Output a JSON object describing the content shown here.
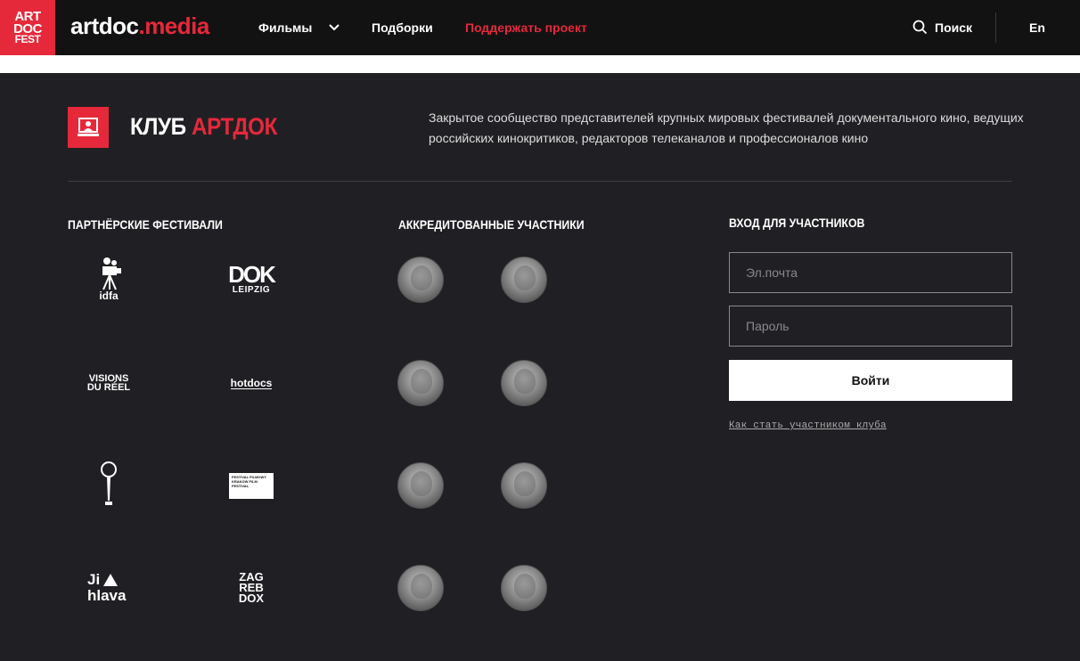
{
  "header": {
    "logo_lines": [
      "ART",
      "DOC",
      "FEST"
    ],
    "brand_main": "artdoc",
    "brand_dot": ".media",
    "nav": {
      "films": "Фильмы",
      "collections": "Подборки",
      "support": "Поддержать проект"
    },
    "search_label": "Поиск",
    "lang_label": "En"
  },
  "club": {
    "title_white": "КЛУБ",
    "title_red": "АРТДОК",
    "description": "Закрытое сообщество представителей крупных мировых фестивалей документального кино, ведущих российских кинокритиков, редакторов телеканалов и профессионалов кино"
  },
  "sections": {
    "partners": "ПАРТНЁРСКИЕ ФЕСТИВАЛИ",
    "members": "АККРЕДИТОВАННЫЕ УЧАСТНИКИ",
    "login": "ВХОД ДЛЯ УЧАСТНИКОВ"
  },
  "festivals": [
    {
      "name": "idfa"
    },
    {
      "name": "DOK LEIPZIG"
    },
    {
      "name": "VISIONS DU RÉEL"
    },
    {
      "name": "hotdocs"
    },
    {
      "name": "festival-statuette"
    },
    {
      "name": "KRAKOW FILM FESTIVAL"
    },
    {
      "name": "Ji hlava"
    },
    {
      "name": "ZAG REB DOX"
    }
  ],
  "festival_labels": {
    "idfa": "idfa",
    "dok": "DOK",
    "leipzig": "LEIPZIG",
    "visions1": "VISIONS",
    "visions2": "DU RÉEL",
    "hotdocs": "hotdocs",
    "krakow": "FESTIVAL FILMOWY KRAKOW FILM FESTIVAL",
    "jihlava1": "Ji",
    "jihlava2": "hlava",
    "zag": "ZAG",
    "reb": "REB",
    "dox": "DOX"
  },
  "login": {
    "email_placeholder": "Эл.почта",
    "password_placeholder": "Пароль",
    "submit": "Войти",
    "join_link": "Как стать участником клуба"
  },
  "colors": {
    "accent": "#e6283b",
    "background": "#202024",
    "header": "#121212"
  }
}
